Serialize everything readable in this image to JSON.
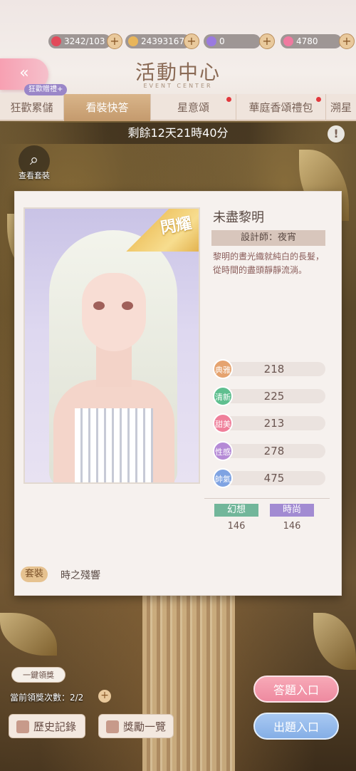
{
  "resources": {
    "stamina": "3242/103",
    "gold": "24393167",
    "crystal": "0",
    "diamond": "4780"
  },
  "header": {
    "title": "活動中心",
    "subtitle": "EVENT CENTER",
    "gift_badge": "狂歡贈禮+"
  },
  "tabs": [
    {
      "label": "狂歡累儲",
      "active": false,
      "dot": false
    },
    {
      "label": "看裝快答",
      "active": true,
      "dot": false
    },
    {
      "label": "星意頌",
      "active": false,
      "dot": true
    },
    {
      "label": "華庭香頌禮包",
      "active": false,
      "dot": true
    },
    {
      "label": "溯星",
      "active": false,
      "dot": false
    }
  ],
  "timer": "剩餘12天21時40分",
  "view_outfit_label": "查看套裝",
  "card": {
    "ribbon": "閃耀",
    "name": "未盡黎明",
    "designer": "設計師：夜宵",
    "description": "黎明的晝光織就純白的長髮，從時間的盡頭靜靜流淌。",
    "stats": [
      {
        "label": "典雅",
        "value": "218",
        "color": "#e5a36f"
      },
      {
        "label": "清新",
        "value": "225",
        "color": "#5fbf8f"
      },
      {
        "label": "甜美",
        "value": "213",
        "color": "#ef7f9a"
      },
      {
        "label": "性感",
        "value": "278",
        "color": "#b58ad6"
      },
      {
        "label": "帥氣",
        "value": "475",
        "color": "#7fa3e2"
      }
    ],
    "categories": [
      {
        "label": "幻想",
        "value": "146",
        "color": "#72b69a"
      },
      {
        "label": "時尚",
        "value": "146",
        "color": "#a28bd2"
      }
    ],
    "suit_tag": "套裝",
    "suit_name": "時之殘響"
  },
  "bottom": {
    "one_key": "一鍵領獎",
    "count": "當前領獎次數：2/2",
    "history": "歷史記錄",
    "rewards": "獎勵一覽",
    "answer": "答題入口",
    "ask": "出題入口"
  }
}
